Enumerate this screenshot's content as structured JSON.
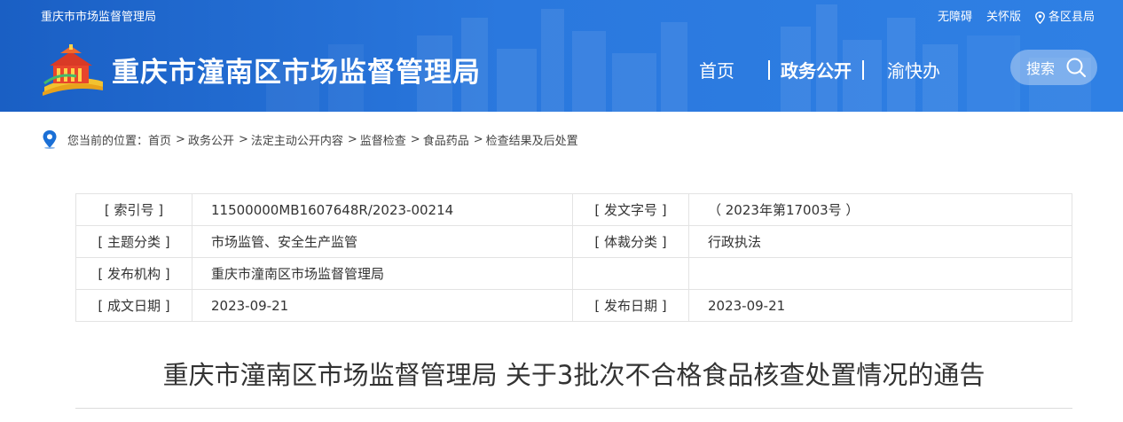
{
  "header": {
    "site_name_small": "重庆市市场监督管理局",
    "title": "重庆市潼南区市场监督管理局",
    "top_links": [
      "无障碍",
      "关怀版",
      "各区县局"
    ],
    "nav": {
      "home": "首页",
      "active": "政务公开",
      "fast": "渝快办"
    },
    "search_label": "搜索"
  },
  "breadcrumb": {
    "prefix": "您当前的位置：",
    "items": [
      "首页",
      "政务公开",
      "法定主动公开内容",
      "监督检查",
      "食品药品",
      "检查结果及后处置"
    ],
    "separator": ">"
  },
  "meta": {
    "rows": [
      {
        "k1": "[ 索引号 ]",
        "v1": "11500000MB1607648R/2023-00214",
        "k2": "[ 发文字号 ]",
        "v2": "（ 2023年第17003号 ）"
      },
      {
        "k1": "[ 主题分类 ]",
        "v1": "市场监管、安全生产监管",
        "k2": "[ 体裁分类 ]",
        "v2": "行政执法"
      },
      {
        "k1": "[ 发布机构 ]",
        "v1": "重庆市潼南区市场监督管理局",
        "k2": "",
        "v2": ""
      },
      {
        "k1": "[ 成文日期 ]",
        "v1": "2023-09-21",
        "k2": "[ 发布日期 ]",
        "v2": "2023-09-21"
      }
    ]
  },
  "article": {
    "title": "重庆市潼南区市场监督管理局 关于3批次不合格食品核查处置情况的通告"
  },
  "colors": {
    "header_blue": "#2a78de",
    "icon_blue": "#1a6fd6"
  }
}
